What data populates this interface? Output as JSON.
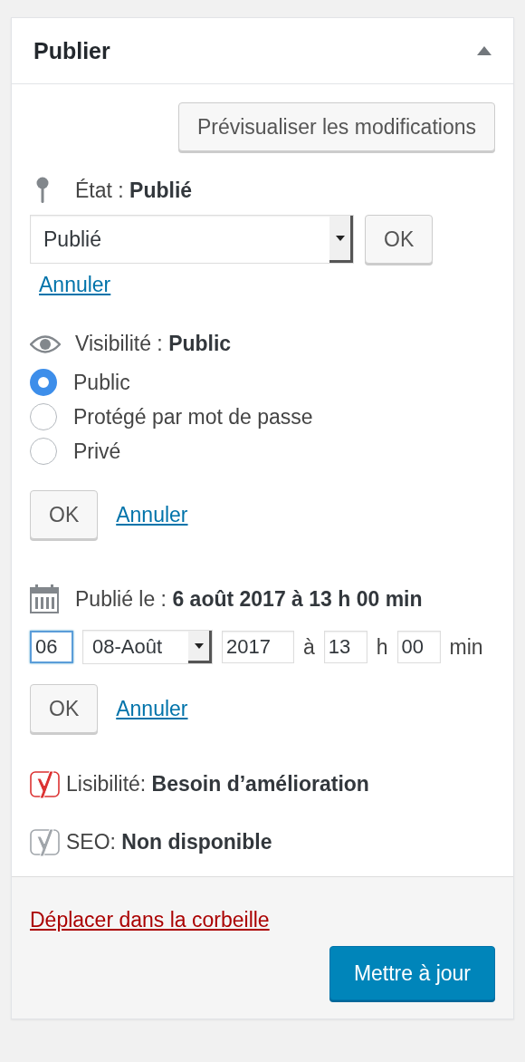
{
  "panel": {
    "title": "Publier",
    "expanded": true
  },
  "preview_button": "Prévisualiser les modifications",
  "status": {
    "label": "État :",
    "value": "Publié",
    "select_value": "Publié",
    "ok": "OK",
    "cancel": "Annuler"
  },
  "visibility": {
    "label": "Visibilité :",
    "value": "Public",
    "options": [
      {
        "label": "Public",
        "selected": true
      },
      {
        "label": "Protégé par mot de passe",
        "selected": false
      },
      {
        "label": "Privé",
        "selected": false
      }
    ],
    "ok": "OK",
    "cancel": "Annuler"
  },
  "date": {
    "label": "Publié le :",
    "value": "6 août 2017 à 13 h 00 min",
    "fields": [
      {
        "kind": "input",
        "value": "06",
        "focused": true
      },
      {
        "kind": "select",
        "value": "08-Août"
      },
      {
        "kind": "input",
        "value": "2017",
        "focused": false
      },
      {
        "kind": "text",
        "text": "à"
      },
      {
        "kind": "input",
        "value": "13",
        "focused": false
      },
      {
        "kind": "text",
        "text": "h"
      },
      {
        "kind": "input",
        "value": "00",
        "focused": false
      },
      {
        "kind": "text",
        "text": "min"
      }
    ],
    "ok": "OK",
    "cancel": "Annuler"
  },
  "seo_checks": [
    {
      "label": "Lisibilité:",
      "value": "Besoin d’amélioration",
      "color": "#dc3232"
    },
    {
      "label": "SEO:",
      "value": "Non disponible",
      "color": "#a0a5aa"
    }
  ],
  "footer": {
    "trash": "Déplacer dans la corbeille",
    "update": "Mettre à jour"
  }
}
